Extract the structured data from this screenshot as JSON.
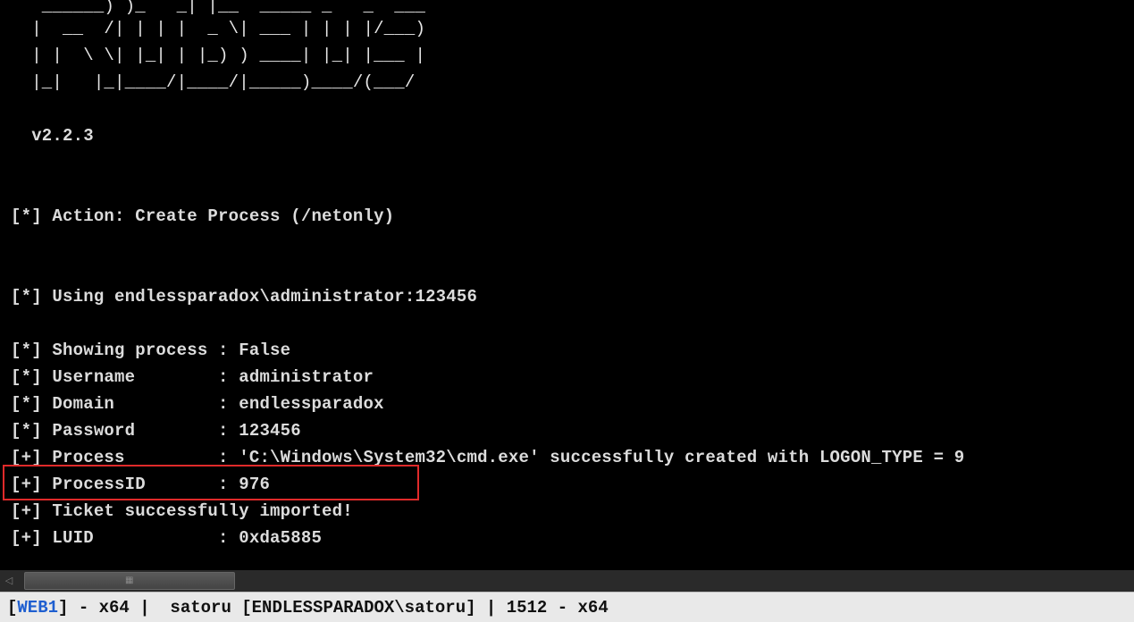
{
  "console": {
    "banner_lines": [
      "   ______) )_   _| |__  _____ _   _  ___",
      "  |  __  /| | | |  _ \\| ___ | | | |/___)",
      "  | |  \\ \\| |_| | |_) ) ____| |_| |___ |",
      "  |_|   |_|____/|____/|_____)____/(___/"
    ],
    "version": "  v2.2.3",
    "action_line": "[*] Action: Create Process (/netonly)",
    "using_line": "[*] Using endlessparadox\\administrator:123456",
    "showing_process_line": "[*] Showing process : False",
    "username_line": "[*] Username        : administrator",
    "domain_line": "[*] Domain          : endlessparadox",
    "password_line": "[*] Password        : 123456",
    "process_line": "[+] Process         : 'C:\\Windows\\System32\\cmd.exe' successfully created with LOGON_TYPE = 9",
    "process_id_line": "[+] ProcessID       : 976",
    "ticket_line": "[+] Ticket successfully imported!",
    "luid_line": "[+] LUID            : 0xda5885"
  },
  "statusbar": {
    "bracket_open": "[",
    "beacon_name": "WEB1",
    "rest": "] - x64 |  satoru [ENDLESSPARADOX\\satoru] | 1512 - x64"
  },
  "colors": {
    "console_background": "#000000",
    "console_text": "#dcdcdc",
    "highlight_box": "#e02a2a",
    "statusbar_background": "#e9e9e9",
    "beacon_name": "#1f5fd0"
  },
  "icons": {
    "scroll_left": "scroll-left-arrow-icon",
    "scroll_grip": "scroll-grip-icon"
  }
}
